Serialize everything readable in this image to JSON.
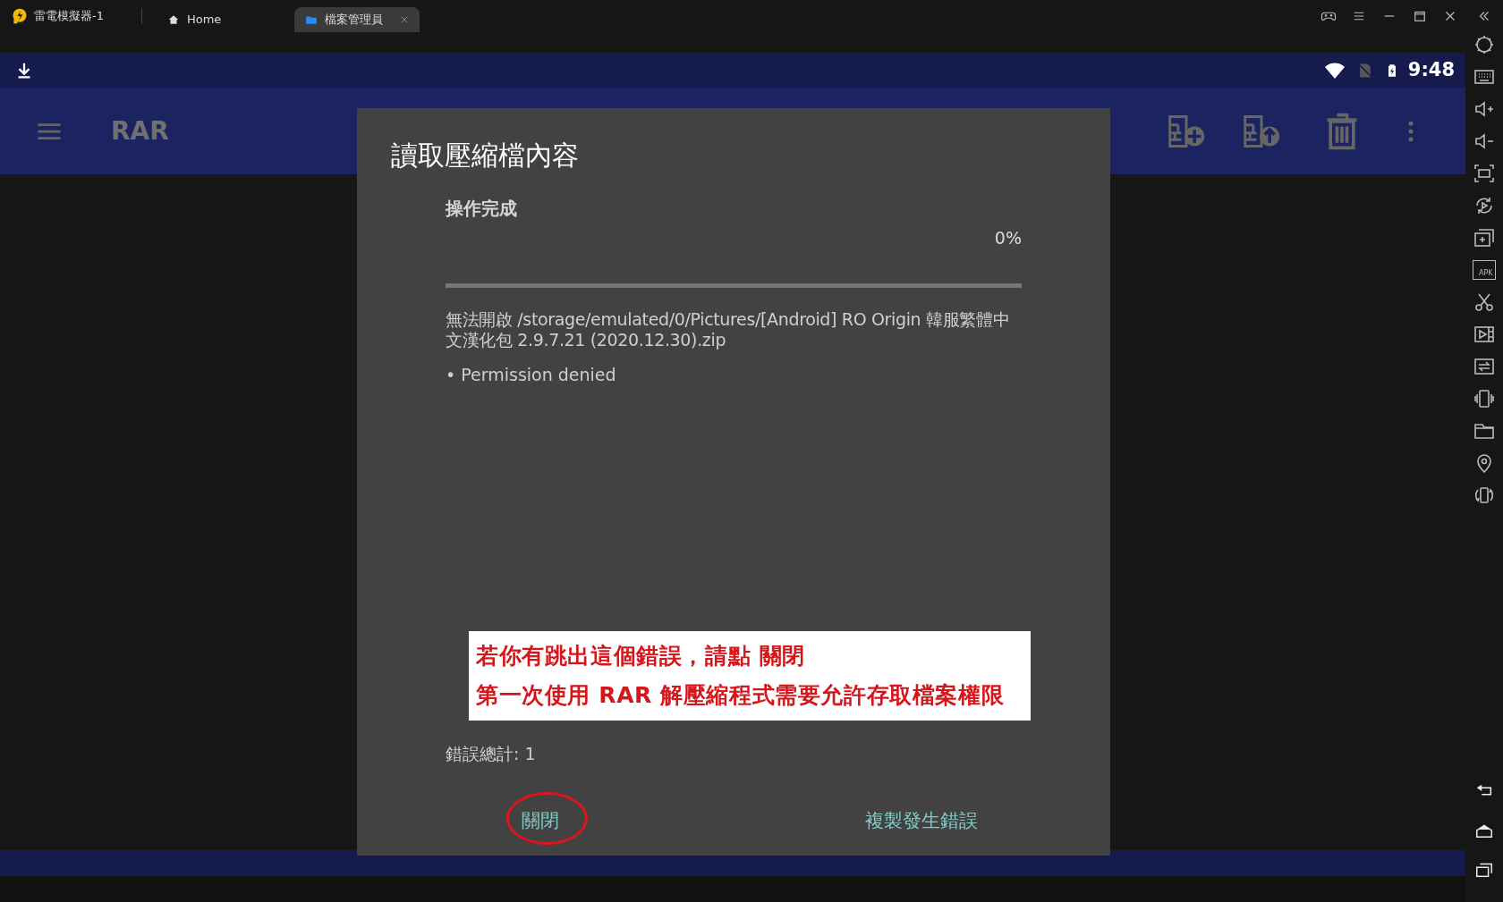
{
  "window": {
    "app_title": "雷電模擬器-1",
    "tabs": [
      {
        "label": "Home",
        "kind": "home",
        "selected": false,
        "closable": false
      },
      {
        "label": "檔案管理員",
        "kind": "folder",
        "selected": true,
        "closable": true
      }
    ]
  },
  "status_bar": {
    "time": "9:48"
  },
  "app_bar": {
    "title": "RAR"
  },
  "sidebar": {
    "apk_label": "APK"
  },
  "dialog": {
    "title": "讀取壓縮檔內容",
    "status": "操作完成",
    "percent": "0%",
    "level": 0,
    "message": "無法開啟 /storage/emulated/0/Pictures/[Android] RO Origin 韓服繁體中文漢化包 2.9.7.21 (2020.12.30).zip",
    "details": [
      "• Permission denied"
    ],
    "error_total": "錯誤總計: 1",
    "buttons": [
      {
        "label": "關閉",
        "highlighted": true
      },
      {
        "label": "複製發生錯誤",
        "highlighted": false
      }
    ]
  },
  "annotation": {
    "lines": [
      "若你有跳出這個錯誤，請點 關閉",
      "第一次使用 RAR 解壓縮程式需要允許存取檔案權限"
    ]
  }
}
